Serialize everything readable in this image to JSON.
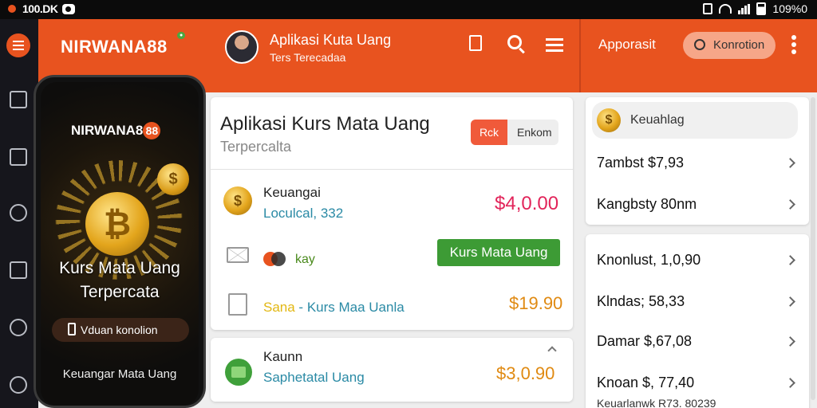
{
  "status_bar": {
    "left_text": "100.DK",
    "battery_text": "109%0"
  },
  "app_bar": {
    "brand": "NIRWANA88",
    "title": "Aplikasi Kuta Uang",
    "subtitle": "Ters Terecadaa",
    "right_title": "Apporasit",
    "search_button_label": "Konrotion"
  },
  "phone": {
    "brand": "NIRWANA8",
    "brand_badge": "88",
    "coin_symbol": "₿",
    "small_coin_symbol": "$",
    "headline_1": "Kurs Mata Uang",
    "headline_2": "Terpercata",
    "button_label": "Vduan konolion",
    "footer": "Keuangar Mata Uang"
  },
  "main_card": {
    "title": "Aplikasi Kurs Mata Uang",
    "subtitle": "Terpercalta",
    "toggle_a": "Rck",
    "toggle_b": "Enkom",
    "row1": {
      "coin_symbol": "$",
      "name": "Keuangai",
      "sub": "Loculcal, 332",
      "value": "$4,0.00"
    },
    "row2": {
      "label": "kay",
      "button": "Kurs Mata Uang"
    },
    "row3": {
      "highlight": "Sana",
      "separator": " - ",
      "label": "Kurs Maa Uanla",
      "value": "$19.90"
    }
  },
  "bottom_card": {
    "name": "Kaunn",
    "sub": "Saphetatal Uang",
    "value": "$3,0.90"
  },
  "right_card_1": {
    "pill_coin_symbol": "$",
    "pill_label": "Keuahlag",
    "items": [
      "7ambst $7,93",
      "Kangbsty 80nm"
    ]
  },
  "right_card_2": {
    "items": [
      "Knonlust, 1,0,90",
      "Klndas; 58,33",
      "Damar $,67,08",
      "Knoan $, 77,40"
    ],
    "footer": "Keuarlanwk R73. 80239"
  },
  "colors": {
    "accent": "#e8531f",
    "green": "#3d9b35",
    "value_red": "#e2245a",
    "value_orange": "#e08a12"
  }
}
